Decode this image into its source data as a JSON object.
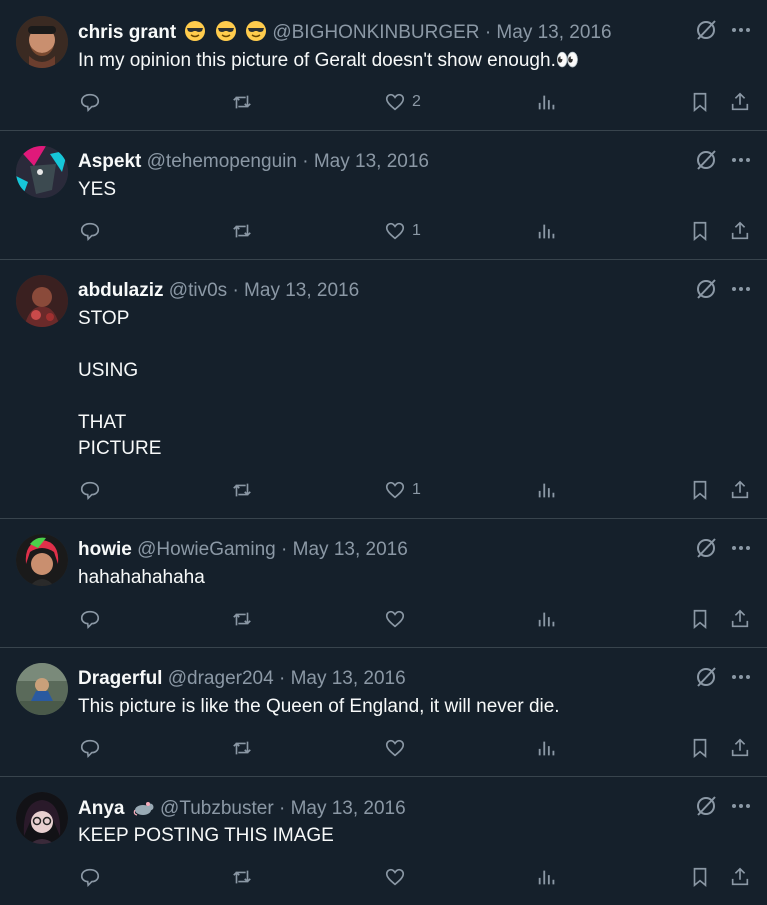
{
  "tweets": [
    {
      "name": "chris grant",
      "handle": "@BIGHONKINBURGER",
      "date": "May 13, 2016",
      "text": "In my opinion this picture of Geralt doesn't show enough.👀",
      "likes": "2",
      "avatar_color": "#6b4a3a"
    },
    {
      "name": "Aspekt",
      "handle": "@tehemopenguin",
      "date": "May 13, 2016",
      "text": "YES",
      "likes": "1",
      "avatar_color": "#e0197a"
    },
    {
      "name": "abdulaziz",
      "handle": "@tiv0s",
      "date": "May 13, 2016",
      "text": "STOP\n\nUSING\n\nTHAT\nPICTURE",
      "likes": "1",
      "avatar_color": "#5a2a2a"
    },
    {
      "name": "howie",
      "handle": "@HowieGaming",
      "date": "May 13, 2016",
      "text": "hahahahahaha",
      "likes": "",
      "avatar_color": "#2a2a2a"
    },
    {
      "name": "Dragerful",
      "handle": "@drager204",
      "date": "May 13, 2016",
      "text": "This picture is like the Queen of England, it will never die.",
      "likes": "",
      "avatar_color": "#4a5a4a"
    },
    {
      "name": "Anya",
      "handle": "@Tubzbuster",
      "date": "May 13, 2016",
      "text": "KEEP POSTING THIS IMAGE",
      "likes": "",
      "avatar_color": "#1e1e24"
    }
  ],
  "separator": "·",
  "icons": {
    "reply": "reply-icon",
    "retweet": "retweet-icon",
    "like": "heart-icon",
    "views": "views-icon",
    "bookmark": "bookmark-icon",
    "share": "share-icon",
    "grok": "grok-icon",
    "more": "more-icon"
  },
  "colors": {
    "background": "#15202b",
    "muted": "#8b98a5",
    "border": "#38444d",
    "text": "#f7f9f9"
  }
}
